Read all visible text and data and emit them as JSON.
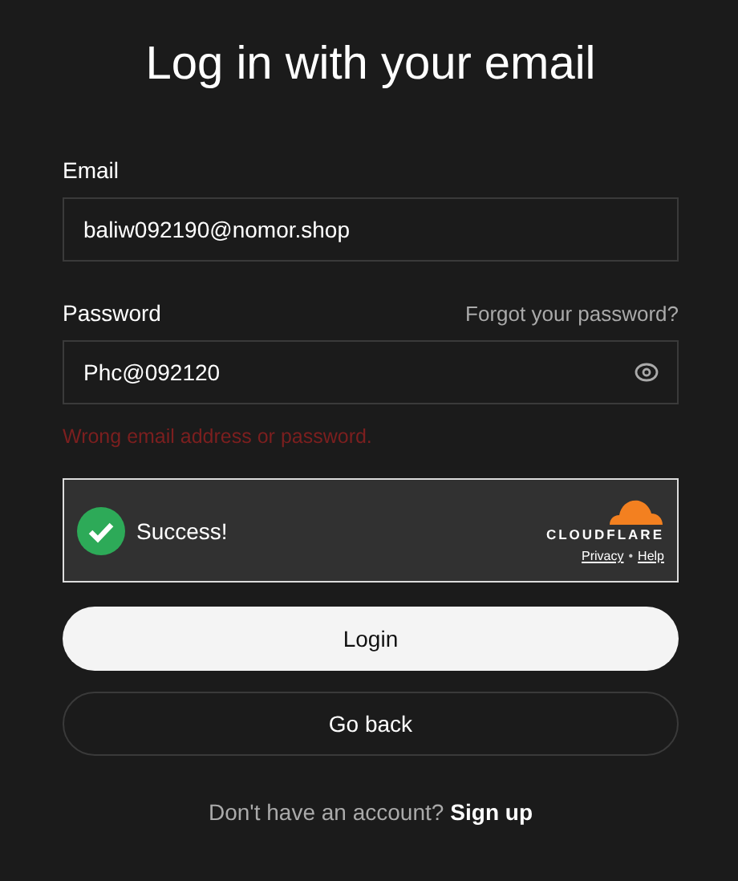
{
  "title": "Log in with your email",
  "email": {
    "label": "Email",
    "value": "baliw092190@nomor.shop"
  },
  "password": {
    "label": "Password",
    "forgot": "Forgot your password?",
    "value": "Phc@092120"
  },
  "error": "Wrong email address or password.",
  "captcha": {
    "status": "Success!",
    "brand": "CLOUDFLARE",
    "links": [
      "Privacy",
      "Help"
    ],
    "separator": "•"
  },
  "buttons": [
    {
      "label": "Login",
      "kind": "primary"
    },
    {
      "label": "Go back",
      "kind": "secondary"
    }
  ],
  "footer": {
    "text": "Don't have an account?",
    "link": "Sign up"
  }
}
